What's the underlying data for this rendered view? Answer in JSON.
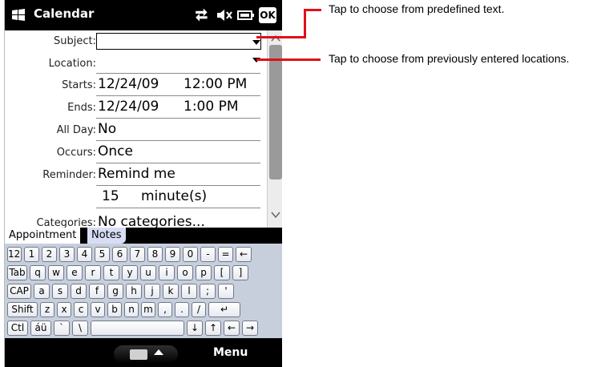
{
  "titlebar": {
    "title": "Calendar",
    "ok_label": "OK",
    "icons": [
      "windows-start-icon",
      "connectivity-icon",
      "volume-muted-icon",
      "battery-icon"
    ]
  },
  "form": {
    "subject_label": "Subject:",
    "subject_value": "",
    "location_label": "Location:",
    "location_value": "",
    "starts_label": "Starts:",
    "starts_date": "12/24/09",
    "starts_time": "12:00 PM",
    "ends_label": "Ends:",
    "ends_date": "12/24/09",
    "ends_time": "1:00 PM",
    "allday_label": "All Day:",
    "allday_value": "No",
    "occurs_label": "Occurs:",
    "occurs_value": "Once",
    "reminder_label": "Reminder:",
    "reminder_value": "Remind me",
    "reminder_amount": "15",
    "reminder_unit": "minute(s)",
    "categories_label": "Categories:",
    "categories_value": "No categories..."
  },
  "tabs": {
    "appointment": "Appointment",
    "notes": "Notes"
  },
  "keyboard": {
    "rows": [
      [
        "123",
        "1",
        "2",
        "3",
        "4",
        "5",
        "6",
        "7",
        "8",
        "9",
        "0",
        "-",
        "=",
        "←"
      ],
      [
        "Tab",
        "q",
        "w",
        "e",
        "r",
        "t",
        "y",
        "u",
        "i",
        "o",
        "p",
        "[",
        "]"
      ],
      [
        "CAP",
        "a",
        "s",
        "d",
        "f",
        "g",
        "h",
        "j",
        "k",
        "l",
        ";",
        "'"
      ],
      [
        "Shift",
        "z",
        "x",
        "c",
        "v",
        "b",
        "n",
        "m",
        ",",
        ".",
        "/",
        "↵"
      ],
      [
        "Ctl",
        "áü",
        "`",
        "\\",
        "",
        "↓",
        "↑",
        "←",
        "→"
      ]
    ]
  },
  "softkeys": {
    "right": "Menu"
  },
  "callouts": {
    "subject_note": "Tap to choose from predefined text.",
    "location_note": "Tap to choose from previously entered locations."
  },
  "colors": {
    "callout_line": "#e0101a",
    "titlebar_bg": "#000000",
    "keyboard_bg": "#c8cfdc",
    "notes_tab_bg": "#d6ddf4"
  }
}
